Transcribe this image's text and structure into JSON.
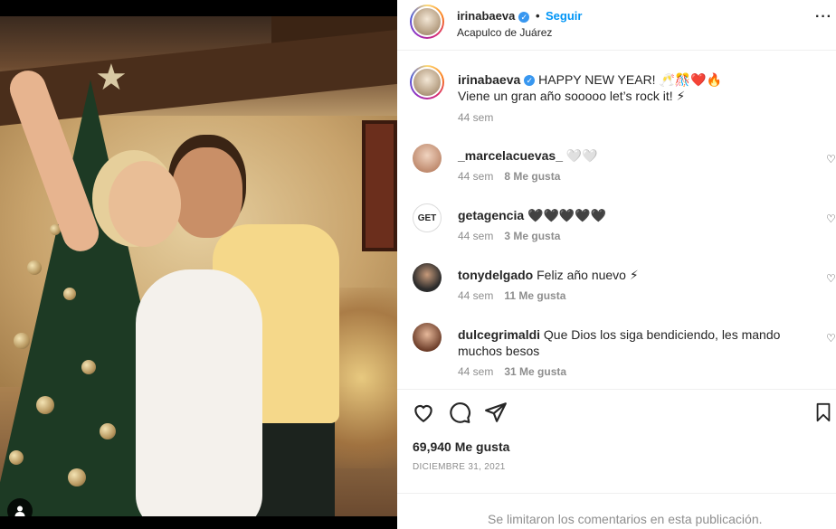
{
  "post": {
    "username": "irinabaeva",
    "follow_label": "Seguir",
    "location": "Acapulco de Juárez",
    "more_label": "···",
    "photo_tag_icon": "user-tag-icon"
  },
  "caption": {
    "username": "irinabaeva",
    "text_line1": "HAPPY NEW YEAR! 🥂🎊❤️🔥",
    "text_line2": "Viene un gran año sooooo let’s rock it! ⚡",
    "time": "44 sem"
  },
  "comments": [
    {
      "username": "_marcelacuevas_",
      "text": "🤍🤍",
      "time": "44 sem",
      "likes": "8 Me gusta",
      "avatar_color": "#d9b29a"
    },
    {
      "username": "getagencia",
      "text": "🖤🖤🖤🖤🖤",
      "time": "44 sem",
      "likes": "3 Me gusta",
      "avatar_label": "GET",
      "avatar_color": "#ffffff"
    },
    {
      "username": "tonydelgado",
      "text": "Feliz año nuevo ⚡",
      "time": "44 sem",
      "likes": "11 Me gusta",
      "avatar_color": "#2b2b2b"
    },
    {
      "username": "dulcegrimaldi",
      "text": "Que Dios los siga bendiciendo, les mando muchos besos",
      "time": "44 sem",
      "likes": "31 Me gusta",
      "avatar_color": "#8a5a44"
    }
  ],
  "footer": {
    "likes": "69,940 Me gusta",
    "date": "DICIEMBRE 31, 2021",
    "comments_limited": "Se limitaron los comentarios en esta publicación."
  },
  "colors": {
    "accent": "#0095f6",
    "verified": "#3897f0",
    "muted": "#8e8e8e"
  }
}
